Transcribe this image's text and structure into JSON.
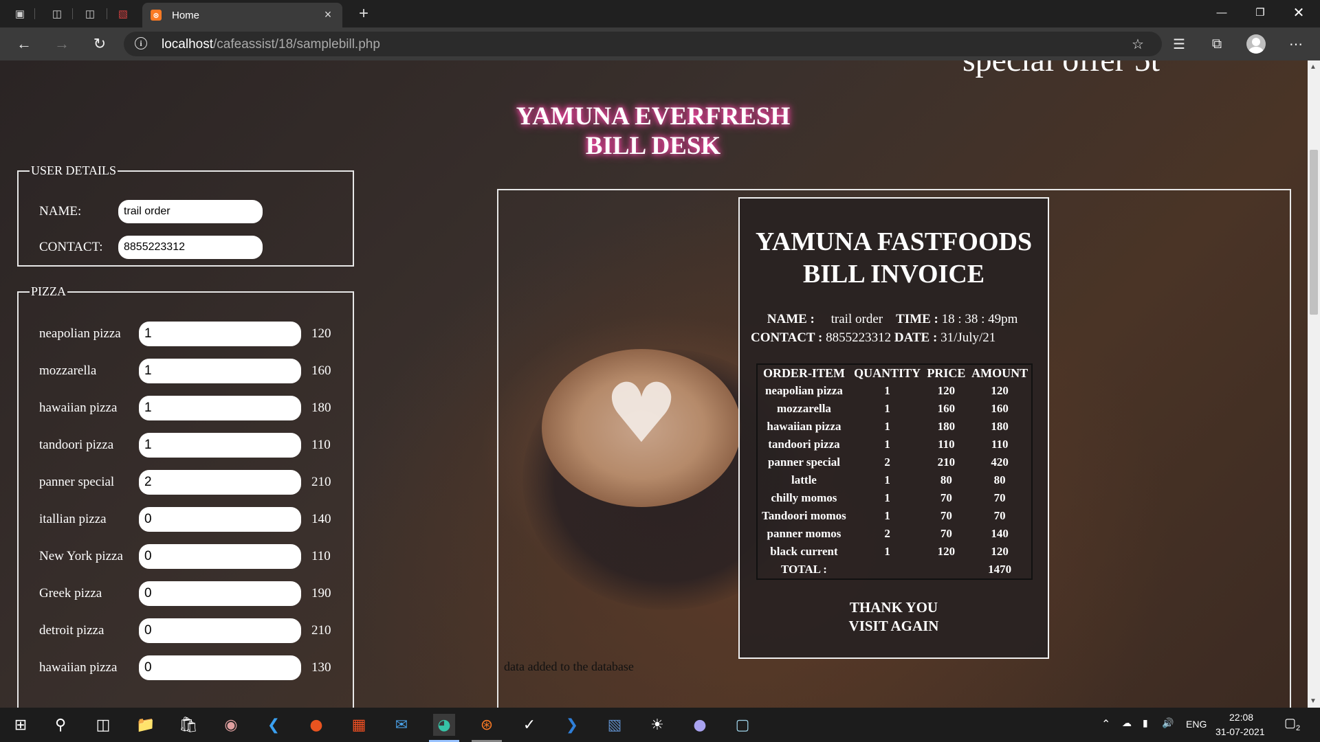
{
  "browser": {
    "tab_title": "Home",
    "tab_icon": "xampp-icon",
    "url_host": "localhost",
    "url_path": "/cafeassist/18/samplebill.php"
  },
  "page": {
    "cut_title": "special offer 5t",
    "title_line1": "YAMUNA EVERFRESH",
    "title_line2": "BILL DESK",
    "user_details": {
      "legend": "USER DETAILS",
      "name_label": "NAME:",
      "name_value": "trail order",
      "contact_label": "CONTACT:",
      "contact_value": "8855223312"
    },
    "pizza": {
      "legend": "PIZZA",
      "items": [
        {
          "name": "neapolian pizza",
          "qty": "1",
          "price": "120"
        },
        {
          "name": "mozzarella",
          "qty": "1",
          "price": "160"
        },
        {
          "name": "hawaiian pizza",
          "qty": "1",
          "price": "180"
        },
        {
          "name": "tandoori pizza",
          "qty": "1",
          "price": "110"
        },
        {
          "name": "panner special",
          "qty": "2",
          "price": "210"
        },
        {
          "name": "itallian pizza",
          "qty": "0",
          "price": "140"
        },
        {
          "name": "New York pizza",
          "qty": "0",
          "price": "110"
        },
        {
          "name": "Greek pizza",
          "qty": "0",
          "price": "190"
        },
        {
          "name": "detroit pizza",
          "qty": "0",
          "price": "210"
        },
        {
          "name": "hawaiian pizza",
          "qty": "0",
          "price": "130"
        }
      ]
    },
    "invoice": {
      "title_line1": "YAMUNA FASTFOODS",
      "title_line2": "BILL INVOICE",
      "name_label": "NAME :",
      "name_value": "trail order",
      "time_label": "TIME :",
      "time_value": "18 : 38 : 49pm",
      "contact_label": "CONTACT :",
      "contact_value": "8855223312",
      "date_label": "DATE :",
      "date_value": "31/July/21",
      "headers": [
        "ORDER-ITEM",
        "QUANTITY",
        "PRICE",
        "AMOUNT"
      ],
      "rows": [
        {
          "item": "neapolian pizza",
          "qty": "1",
          "price": "120",
          "amount": "120"
        },
        {
          "item": "mozzarella",
          "qty": "1",
          "price": "160",
          "amount": "160"
        },
        {
          "item": "hawaiian pizza",
          "qty": "1",
          "price": "180",
          "amount": "180"
        },
        {
          "item": "tandoori pizza",
          "qty": "1",
          "price": "110",
          "amount": "110"
        },
        {
          "item": "panner special",
          "qty": "2",
          "price": "210",
          "amount": "420"
        },
        {
          "item": "lattle",
          "qty": "1",
          "price": "80",
          "amount": "80"
        },
        {
          "item": "chilly momos",
          "qty": "1",
          "price": "70",
          "amount": "70"
        },
        {
          "item": "Tandoori momos",
          "qty": "1",
          "price": "70",
          "amount": "70"
        },
        {
          "item": "panner momos",
          "qty": "2",
          "price": "70",
          "amount": "140"
        },
        {
          "item": "black current",
          "qty": "1",
          "price": "120",
          "amount": "120"
        }
      ],
      "total_label": "TOTAL :",
      "total_value": "1470",
      "thanks_line1": "THANK YOU",
      "thanks_line2": "VISIT AGAIN"
    },
    "db_message": "data added to the database"
  },
  "taskbar": {
    "language": "ENG",
    "time": "22:08",
    "date": "31-07-2021",
    "notification_count": "2"
  }
}
